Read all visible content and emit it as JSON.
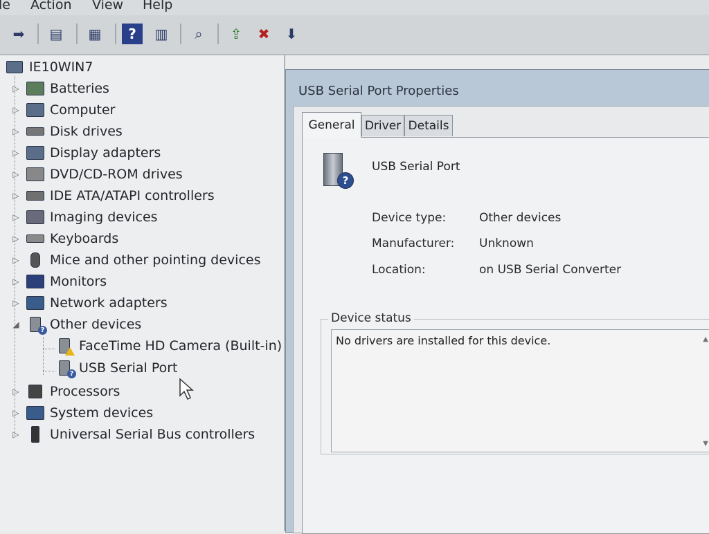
{
  "menu": {
    "items": [
      "le",
      "Action",
      "View",
      "Help"
    ]
  },
  "toolbar": {
    "icons": [
      "forward-arrow-icon",
      "show-hide-tree-icon",
      "properties-icon",
      "help-icon",
      "action-pane-icon",
      "scan-hardware-icon",
      "update-driver-icon",
      "uninstall-icon",
      "disable-device-icon"
    ]
  },
  "tree": {
    "root": "IE10WIN7",
    "items": [
      {
        "label": "Batteries",
        "icon": "battery-icon"
      },
      {
        "label": "Computer",
        "icon": "computer-icon"
      },
      {
        "label": "Disk drives",
        "icon": "disk-drive-icon"
      },
      {
        "label": "Display adapters",
        "icon": "display-adapter-icon"
      },
      {
        "label": "DVD/CD-ROM drives",
        "icon": "dvd-drive-icon"
      },
      {
        "label": "IDE ATA/ATAPI controllers",
        "icon": "ide-controller-icon"
      },
      {
        "label": "Imaging devices",
        "icon": "imaging-device-icon"
      },
      {
        "label": "Keyboards",
        "icon": "keyboard-icon"
      },
      {
        "label": "Mice and other pointing devices",
        "icon": "mouse-icon"
      },
      {
        "label": "Monitors",
        "icon": "monitor-icon"
      },
      {
        "label": "Network adapters",
        "icon": "network-adapter-icon"
      },
      {
        "label": "Other devices",
        "icon": "other-device-icon"
      },
      {
        "label": "FaceTime HD Camera (Built-in)",
        "icon": "warning-device-icon"
      },
      {
        "label": "USB Serial Port",
        "icon": "unknown-device-icon"
      },
      {
        "label": "Processors",
        "icon": "processor-icon"
      },
      {
        "label": "System devices",
        "icon": "system-device-icon"
      },
      {
        "label": "Universal Serial Bus controllers",
        "icon": "usb-controller-icon"
      }
    ]
  },
  "dialog": {
    "title": "USB Serial Port Properties",
    "tabs": [
      "General",
      "Driver",
      "Details"
    ],
    "device_name": "USB Serial Port",
    "props": [
      {
        "label": "Device type:",
        "value": "Other devices"
      },
      {
        "label": "Manufacturer:",
        "value": "Unknown"
      },
      {
        "label": "Location:",
        "value": "on USB Serial Converter"
      }
    ],
    "status_legend": "Device status",
    "status_text": "No drivers are installed for this device."
  },
  "colors": {
    "tree_bg": "#eceef0",
    "dialog_frame": "#b9c8d6",
    "panel_bg": "#f1f2f3"
  }
}
